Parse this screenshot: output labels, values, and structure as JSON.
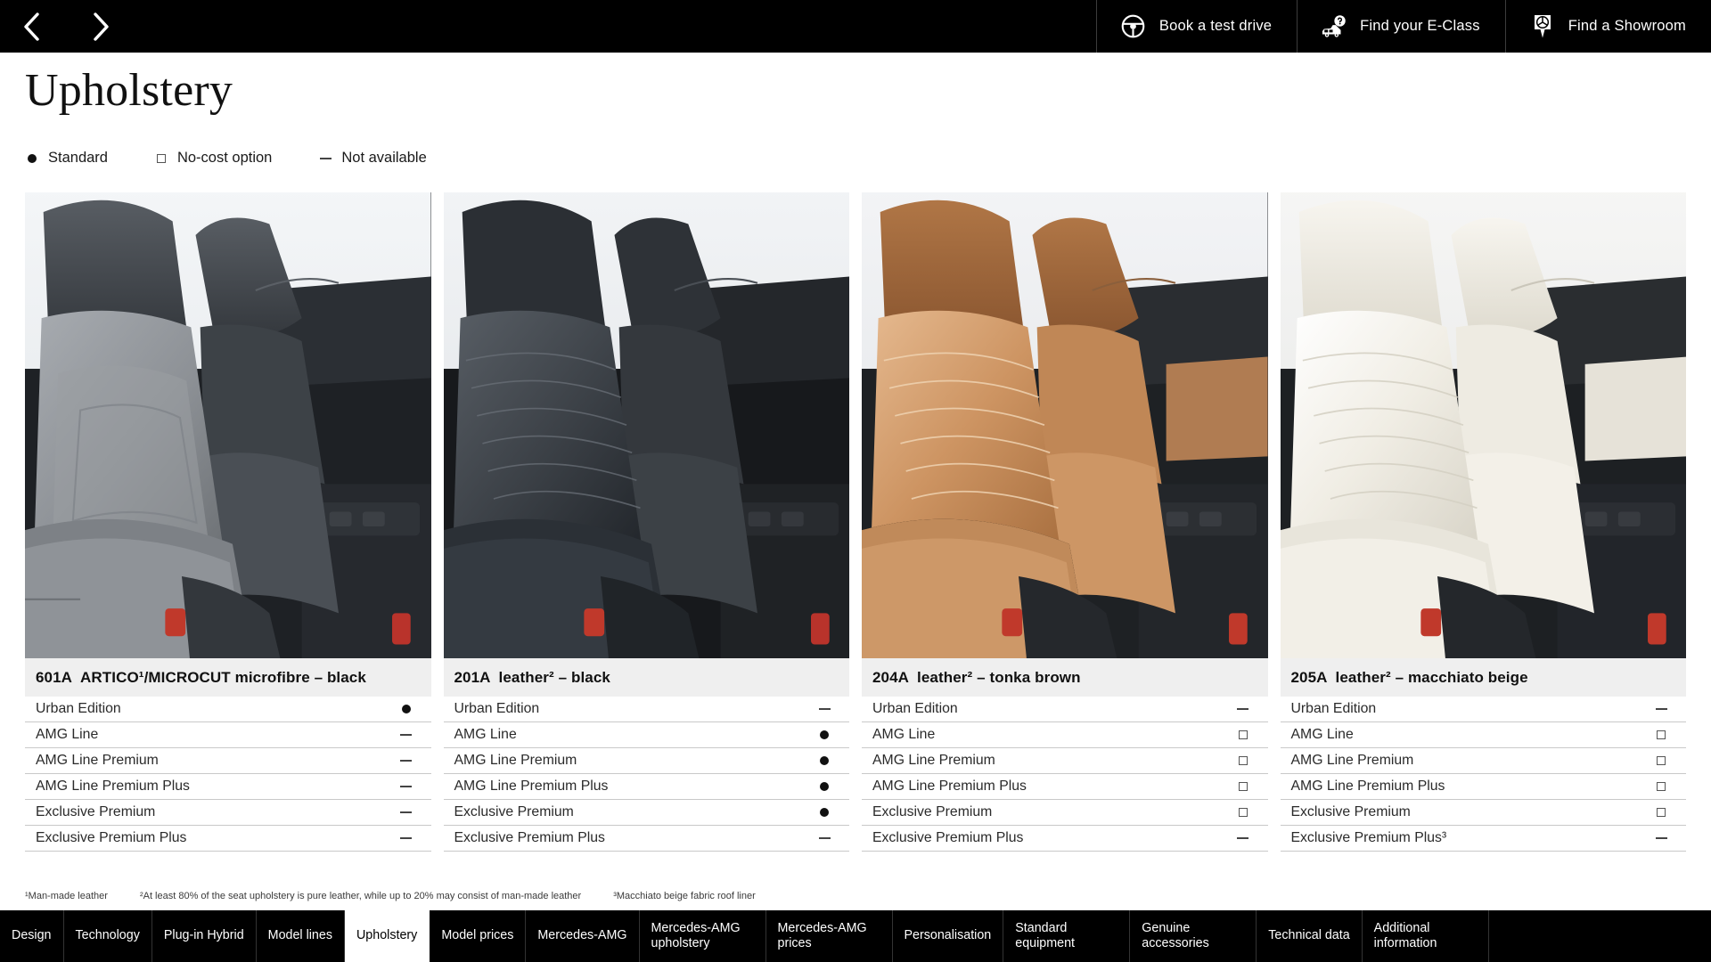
{
  "topbar": {
    "prev_icon": "chevron-left-icon",
    "next_icon": "chevron-right-icon",
    "actions": [
      {
        "label": "Book a test drive",
        "icon": "steering-wheel-icon"
      },
      {
        "label": "Find your E-Class",
        "icon": "car-question-icon"
      },
      {
        "label": "Find a Showroom",
        "icon": "map-pin-mercedes-star-icon"
      }
    ]
  },
  "page": {
    "title": "Upholstery"
  },
  "legend": [
    {
      "symbol": "dot",
      "label": "Standard"
    },
    {
      "symbol": "square",
      "label": "No-cost option"
    },
    {
      "symbol": "dash",
      "label": "Not available"
    }
  ],
  "row_labels": [
    "Urban Edition",
    "AMG Line",
    "AMG Line Premium",
    "AMG Line Premium Plus",
    "Exclusive Premium",
    "Exclusive Premium Plus"
  ],
  "columns": [
    {
      "code": "601A",
      "name": "ARTICO¹/MICROCUT microfibre – black",
      "photo_alt": "car-interior-seats-black-microfibre",
      "seat_color": "#8d9196",
      "rows": [
        {
          "label": "Urban Edition",
          "value": "dot"
        },
        {
          "label": "AMG Line",
          "value": "dash"
        },
        {
          "label": "AMG Line Premium",
          "value": "dash"
        },
        {
          "label": "AMG Line Premium Plus",
          "value": "dash"
        },
        {
          "label": "Exclusive Premium",
          "value": "dash"
        },
        {
          "label": "Exclusive Premium Plus",
          "value": "dash"
        }
      ]
    },
    {
      "code": "201A",
      "name": "leather² – black",
      "photo_alt": "car-interior-seats-black-leather",
      "seat_color": "#3e4347",
      "rows": [
        {
          "label": "Urban Edition",
          "value": "dash"
        },
        {
          "label": "AMG Line",
          "value": "dot"
        },
        {
          "label": "AMG Line Premium",
          "value": "dot"
        },
        {
          "label": "AMG Line Premium Plus",
          "value": "dot"
        },
        {
          "label": "Exclusive Premium",
          "value": "dot"
        },
        {
          "label": "Exclusive Premium Plus",
          "value": "dash"
        }
      ]
    },
    {
      "code": "204A",
      "name": "leather² – tonka brown",
      "photo_alt": "car-interior-seats-tonka-brown-leather",
      "seat_color": "#c9905f",
      "rows": [
        {
          "label": "Urban Edition",
          "value": "dash"
        },
        {
          "label": "AMG Line",
          "value": "square"
        },
        {
          "label": "AMG Line Premium",
          "value": "square"
        },
        {
          "label": "AMG Line Premium Plus",
          "value": "square"
        },
        {
          "label": "Exclusive Premium",
          "value": "square"
        },
        {
          "label": "Exclusive Premium Plus",
          "value": "dash"
        }
      ]
    },
    {
      "code": "205A",
      "name": "leather² – macchiato beige",
      "photo_alt": "car-interior-seats-macchiato-beige-leather",
      "seat_color": "#efece3",
      "rows": [
        {
          "label": "Urban Edition",
          "value": "dash"
        },
        {
          "label": "AMG Line",
          "value": "square"
        },
        {
          "label": "AMG Line Premium",
          "value": "square"
        },
        {
          "label": "AMG Line Premium Plus",
          "value": "square"
        },
        {
          "label": "Exclusive Premium",
          "value": "square"
        },
        {
          "label": "Exclusive Premium Plus³",
          "value": "dash"
        }
      ]
    }
  ],
  "footnotes": [
    "¹Man-made leather",
    "²At least 80% of the seat upholstery is pure leather, while up to 20% may consist of man-made leather",
    "³Macchiato beige fabric roof liner"
  ],
  "bottom_nav": {
    "active": "Upholstery",
    "tabs": [
      "Design",
      "Technology",
      "Plug-in Hybrid",
      "Model lines",
      "Upholstery",
      "Model prices",
      "Mercedes-AMG",
      "Mercedes-AMG upholstery",
      "Mercedes-AMG prices",
      "Personalisation",
      "Standard equipment",
      "Genuine accessories",
      "Technical data",
      "Additional information"
    ]
  },
  "colors": {
    "bar_black": "#000000",
    "header_grey": "#efefef",
    "rule_grey": "#c9c9c9",
    "text_dark": "#111111"
  }
}
